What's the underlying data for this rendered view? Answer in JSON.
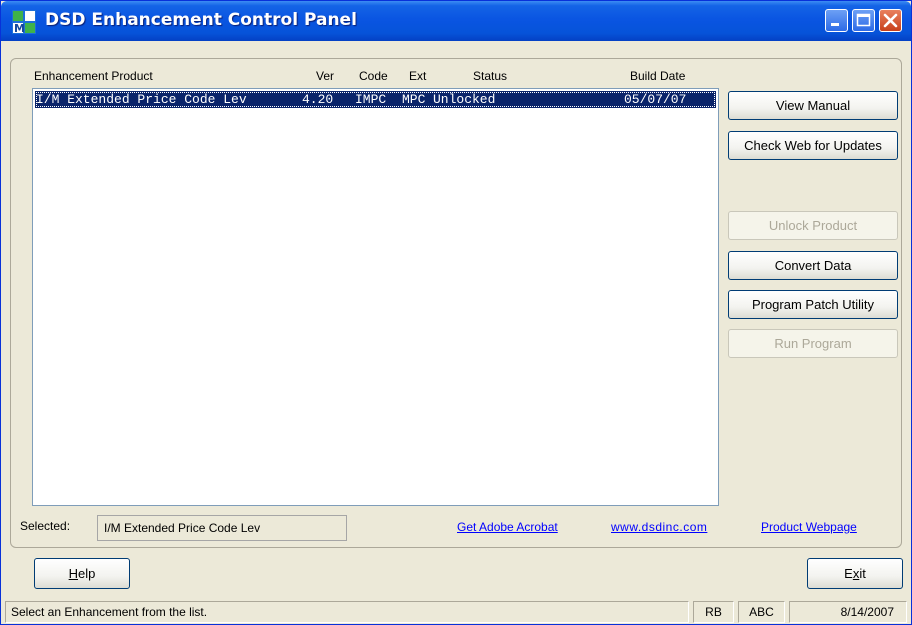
{
  "window": {
    "title": "DSD Enhancement Control Panel"
  },
  "list": {
    "headers": {
      "product": "Enhancement Product",
      "ver": "Ver",
      "code": "Code",
      "ext": "Ext",
      "status": "Status",
      "build_date": "Build Date"
    },
    "rows": [
      {
        "product": "I/M Extended Price Code Lev",
        "ver": "4.20",
        "code": "IMPC",
        "ext": "MPC",
        "status": "Unlocked",
        "build_date": "05/07/07"
      }
    ]
  },
  "buttons": {
    "view_manual": "View Manual",
    "check_web": "Check Web for Updates",
    "unlock_product": "Unlock Product",
    "convert_data": "Convert Data",
    "program_patch": "Program Patch Utility",
    "run_program": "Run Program",
    "help_pre": "",
    "help_u": "H",
    "help_post": "elp",
    "exit_pre": "E",
    "exit_u": "x",
    "exit_post": "it"
  },
  "selected": {
    "label": "Selected:",
    "value": "I/M Extended Price Code Lev"
  },
  "links": {
    "adobe": "Get Adobe Acrobat",
    "website": "www.dsdinc.com",
    "product_page": "Product Webpage"
  },
  "statusbar": {
    "message": "Select an Enhancement from the list.",
    "user": "RB",
    "company": "ABC",
    "date": "8/14/2007"
  },
  "colors": {
    "titlebar": "#0a55e2",
    "selection": "#0a246a",
    "link": "#0000ff",
    "face": "#ece9d8"
  }
}
